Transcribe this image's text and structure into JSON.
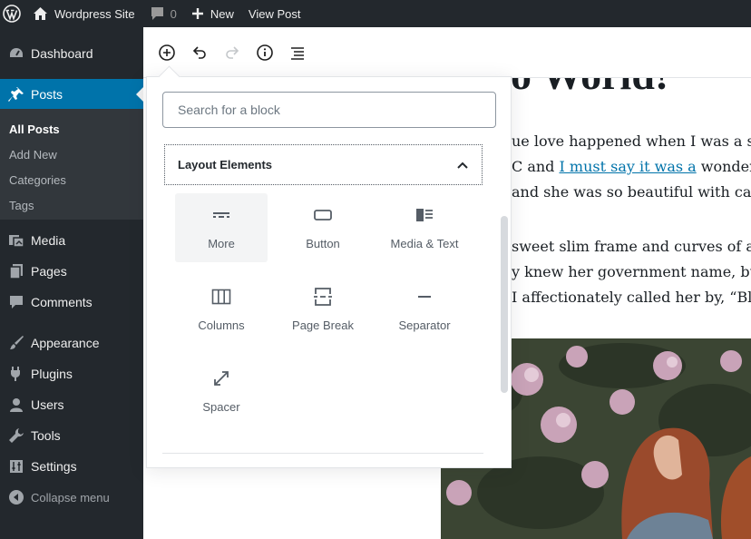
{
  "adminbar": {
    "site_name": "Wordpress Site",
    "comment_count": "0",
    "new_label": "New",
    "view_post_label": "View Post"
  },
  "sidebar": {
    "items": [
      {
        "label": "Dashboard",
        "icon": "dashboard-icon"
      },
      {
        "label": "Posts",
        "icon": "pin-icon"
      },
      {
        "label": "Media",
        "icon": "media-icon"
      },
      {
        "label": "Pages",
        "icon": "pages-icon"
      },
      {
        "label": "Comments",
        "icon": "comment-icon"
      },
      {
        "label": "Appearance",
        "icon": "brush-icon"
      },
      {
        "label": "Plugins",
        "icon": "plugin-icon"
      },
      {
        "label": "Users",
        "icon": "user-icon"
      },
      {
        "label": "Tools",
        "icon": "wrench-icon"
      },
      {
        "label": "Settings",
        "icon": "settings-icon"
      }
    ],
    "submenu": [
      "All Posts",
      "Add New",
      "Categories",
      "Tags"
    ],
    "collapse_label": "Collapse menu"
  },
  "inserter": {
    "search_placeholder": "Search for a block",
    "panel_title": "Layout Elements",
    "blocks": [
      {
        "label": "More",
        "icon": "more-icon"
      },
      {
        "label": "Button",
        "icon": "button-icon"
      },
      {
        "label": "Media & Text",
        "icon": "media-text-icon"
      },
      {
        "label": "Columns",
        "icon": "columns-icon"
      },
      {
        "label": "Page Break",
        "icon": "page-break-icon"
      },
      {
        "label": "Separator",
        "icon": "separator-icon"
      },
      {
        "label": "Spacer",
        "icon": "spacer-icon"
      }
    ]
  },
  "post": {
    "title_fragment": "o World!",
    "lines": [
      {
        "pre": "ue love happened when I was a stu",
        "link": "",
        "post": ""
      },
      {
        "pre": "C and ",
        "link": "I must say it was a",
        "post": " wonderful"
      },
      {
        "pre": " and she was so beautiful with cara",
        "link": "",
        "post": ""
      },
      {
        "pre": "sweet slim frame and curves of a fi",
        "link": "",
        "post": ""
      },
      {
        "pre": "y knew her government name, but,",
        "link": "",
        "post": ""
      },
      {
        "pre": "I affectionately called her by, “Blue",
        "link": "",
        "post": ""
      }
    ]
  },
  "colors": {
    "adminbar_bg": "#23282d",
    "accent": "#0073aa",
    "submenu_bg": "#32373c"
  }
}
